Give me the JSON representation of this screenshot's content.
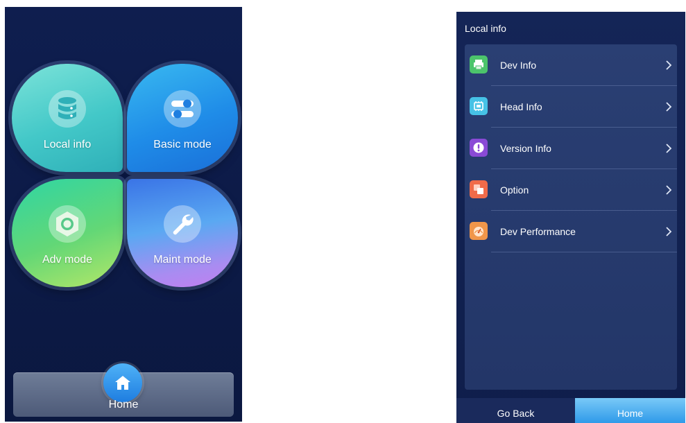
{
  "left_screen": {
    "tiles": [
      {
        "label": "Local info",
        "icon": "database-icon"
      },
      {
        "label": "Basic mode",
        "icon": "toggle-switches-icon"
      },
      {
        "label": "Adv mode",
        "icon": "hex-nut-icon"
      },
      {
        "label": "Maint mode",
        "icon": "wrench-icon"
      }
    ],
    "home": {
      "label": "Home",
      "icon": "home-icon"
    }
  },
  "right_screen": {
    "title": "Local info",
    "items": [
      {
        "label": "Dev Info",
        "icon": "printer-icon",
        "color": "#4cc46b"
      },
      {
        "label": "Head Info",
        "icon": "printhead-icon",
        "color": "#46c2e6"
      },
      {
        "label": "Version Info",
        "icon": "exclamation-icon",
        "color": "#8a4ad6"
      },
      {
        "label": "Option",
        "icon": "option-squares-icon",
        "color": "#f06b4a"
      },
      {
        "label": "Dev Performance",
        "icon": "gauge-icon",
        "color": "#f0964a"
      }
    ],
    "footer": {
      "back_label": "Go Back",
      "home_label": "Home"
    }
  }
}
